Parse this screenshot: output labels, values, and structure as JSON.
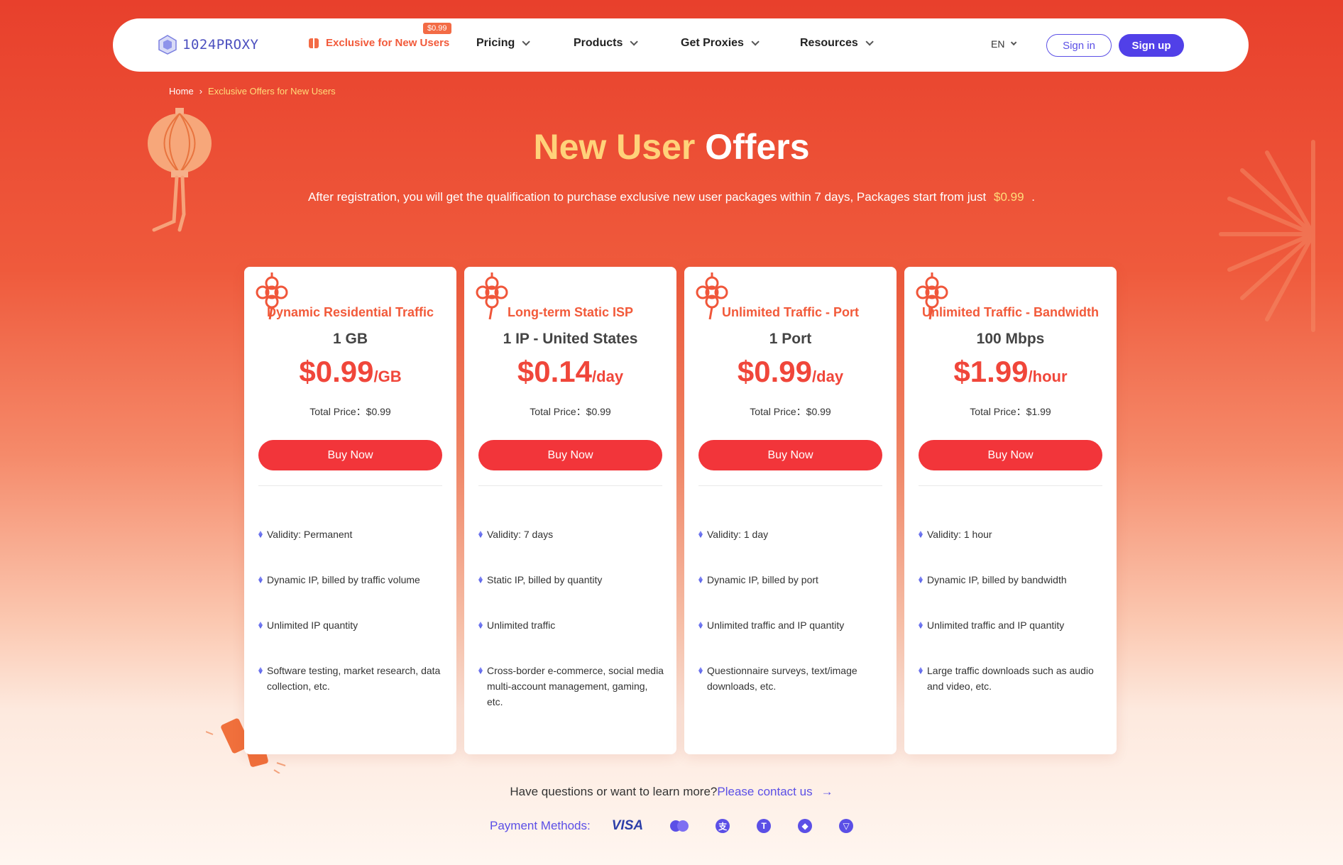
{
  "nav": {
    "logo_text": "1024PROXY",
    "exclusive_label": "Exclusive for New Users",
    "exclusive_tag": "$0.99",
    "items": [
      {
        "label": "Pricing"
      },
      {
        "label": "Products"
      },
      {
        "label": "Get Proxies"
      },
      {
        "label": "Resources"
      }
    ],
    "lang": "EN",
    "signin": "Sign in",
    "signup": "Sign up"
  },
  "breadcrumb": {
    "home": "Home",
    "sep": "›",
    "current": "Exclusive Offers for New Users"
  },
  "hero": {
    "title_a": "New User",
    "title_b": "Offers",
    "subtitle": "After registration, you will get the qualification to purchase exclusive new user packages within 7 days, Packages start from just",
    "subtitle_price": "$0.99",
    "subtitle_end": "."
  },
  "cards": [
    {
      "title": "Dynamic Residential Traffic",
      "qty": "1 GB",
      "price": "$0.99",
      "unit": "/GB",
      "total": "Total Price：$0.99",
      "buy": "Buy Now",
      "features": [
        "Validity: Permanent",
        "Dynamic IP, billed by traffic volume",
        "Unlimited IP quantity",
        "Software testing, market research, data collection, etc."
      ]
    },
    {
      "title": "Long-term Static ISP",
      "qty": "1 IP - United States",
      "price": "$0.14",
      "unit": "/day",
      "total": "Total Price：$0.99",
      "buy": "Buy Now",
      "features": [
        "Validity: 7 days",
        "Static IP, billed by quantity",
        "Unlimited traffic",
        "Cross-border e-commerce, social media multi-account management, gaming, etc."
      ]
    },
    {
      "title": "Unlimited Traffic - Port",
      "qty": "1 Port",
      "price": "$0.99",
      "unit": "/day",
      "total": "Total Price：$0.99",
      "buy": "Buy Now",
      "features": [
        "Validity: 1 day",
        "Dynamic IP, billed by port",
        "Unlimited traffic and IP quantity",
        "Questionnaire surveys, text/image downloads, etc."
      ]
    },
    {
      "title": "Unlimited Traffic - Bandwidth",
      "qty": "100 Mbps",
      "price": "$1.99",
      "unit": "/hour",
      "total": "Total Price：$1.99",
      "buy": "Buy Now",
      "features": [
        "Validity: 1 hour",
        "Dynamic IP, billed by bandwidth",
        "Unlimited traffic and IP quantity",
        "Large traffic downloads such as audio and video, etc."
      ]
    }
  ],
  "contact": {
    "question": "Have questions or want to learn more?",
    "link": "Please contact us",
    "arrow": "→"
  },
  "payments": {
    "label": "Payment Methods:",
    "visa": "VISA",
    "icons": [
      "visa-icon",
      "mastercard-icon",
      "alipay-icon",
      "tether-icon",
      "ethereum-icon",
      "tron-icon"
    ]
  },
  "colors": {
    "accent": "#f2353a",
    "brand": "#5140e8",
    "hero_highlight": "#ffd27a"
  }
}
